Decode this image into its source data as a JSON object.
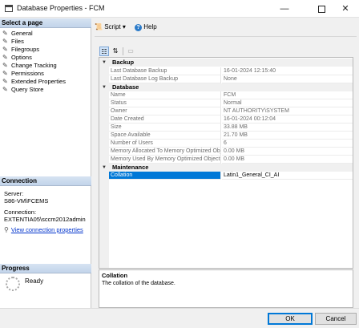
{
  "window": {
    "title": "Database Properties - FCM",
    "minimize_label": "—",
    "close_label": "✕"
  },
  "left": {
    "select_header": "Select a page",
    "pages": [
      {
        "label": "General"
      },
      {
        "label": "Files"
      },
      {
        "label": "Filegroups"
      },
      {
        "label": "Options"
      },
      {
        "label": "Change Tracking"
      },
      {
        "label": "Permissions"
      },
      {
        "label": "Extended Properties"
      },
      {
        "label": "Query Store"
      }
    ],
    "connection_header": "Connection",
    "server_label": "Server:",
    "server_value": "S86-VM\\FCEMS",
    "connection_label": "Connection:",
    "connection_value": "EXTENTIA05\\sccm2012admin",
    "view_conn_link": "View connection properties",
    "progress_header": "Progress",
    "progress_status": "Ready"
  },
  "toolbar": {
    "script_label": "Script",
    "dropdown_glyph": "▾",
    "help_label": "Help"
  },
  "grid": {
    "categories": [
      {
        "name": "Backup",
        "rows": [
          {
            "name": "Last Database Backup",
            "value": "16-01-2024 12:15:40"
          },
          {
            "name": "Last Database Log Backup",
            "value": "None"
          }
        ]
      },
      {
        "name": "Database",
        "rows": [
          {
            "name": "Name",
            "value": "FCM"
          },
          {
            "name": "Status",
            "value": "Normal"
          },
          {
            "name": "Owner",
            "value": "NT AUTHORITY\\SYSTEM"
          },
          {
            "name": "Date Created",
            "value": "16-01-2024 00:12:04"
          },
          {
            "name": "Size",
            "value": "33.88 MB"
          },
          {
            "name": "Space Available",
            "value": "21.70 MB"
          },
          {
            "name": "Number of Users",
            "value": "6"
          },
          {
            "name": "Memory Allocated To Memory Optimized Objects",
            "value": "0.00 MB"
          },
          {
            "name": "Memory Used By Memory Optimized Objects",
            "value": "0.00 MB"
          }
        ]
      },
      {
        "name": "Maintenance",
        "rows": [
          {
            "name": "Collation",
            "value": "Latin1_General_CI_AI"
          }
        ]
      }
    ]
  },
  "description": {
    "title": "Collation",
    "text": "The collation of the database."
  },
  "buttons": {
    "ok": "OK",
    "cancel": "Cancel"
  }
}
